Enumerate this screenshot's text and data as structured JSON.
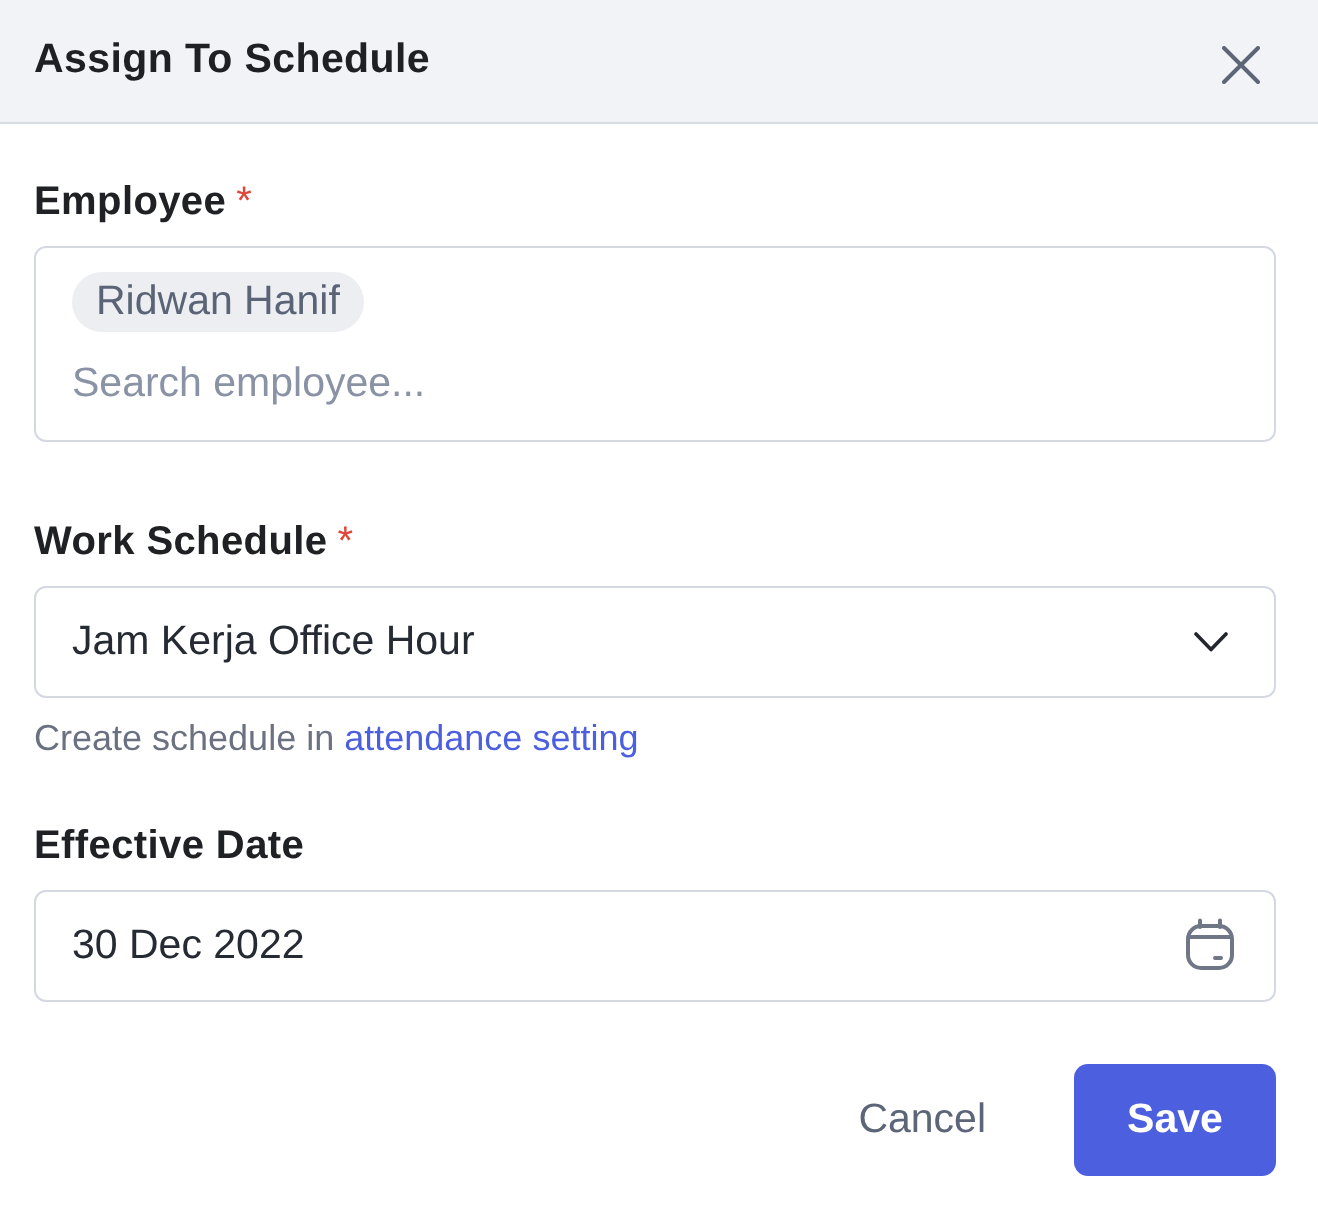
{
  "dialog": {
    "title": "Assign To Schedule"
  },
  "fields": [
    {
      "kind": "tags",
      "label": "Employee",
      "required_mark": "*",
      "tags": [
        "Ridwan Hanif"
      ],
      "placeholder": "Search employee..."
    },
    {
      "kind": "select",
      "label": "Work Schedule",
      "required_mark": "*",
      "value": "Jam Kerja Office Hour",
      "hint": {
        "text": "Create schedule in",
        "link": "attendance setting"
      }
    },
    {
      "kind": "date",
      "label": "Effective Date",
      "value": "30 Dec 2022"
    }
  ],
  "buttons": [
    {
      "kind": "secondary",
      "label": "Cancel"
    },
    {
      "kind": "primary",
      "label": "Save"
    }
  ]
}
